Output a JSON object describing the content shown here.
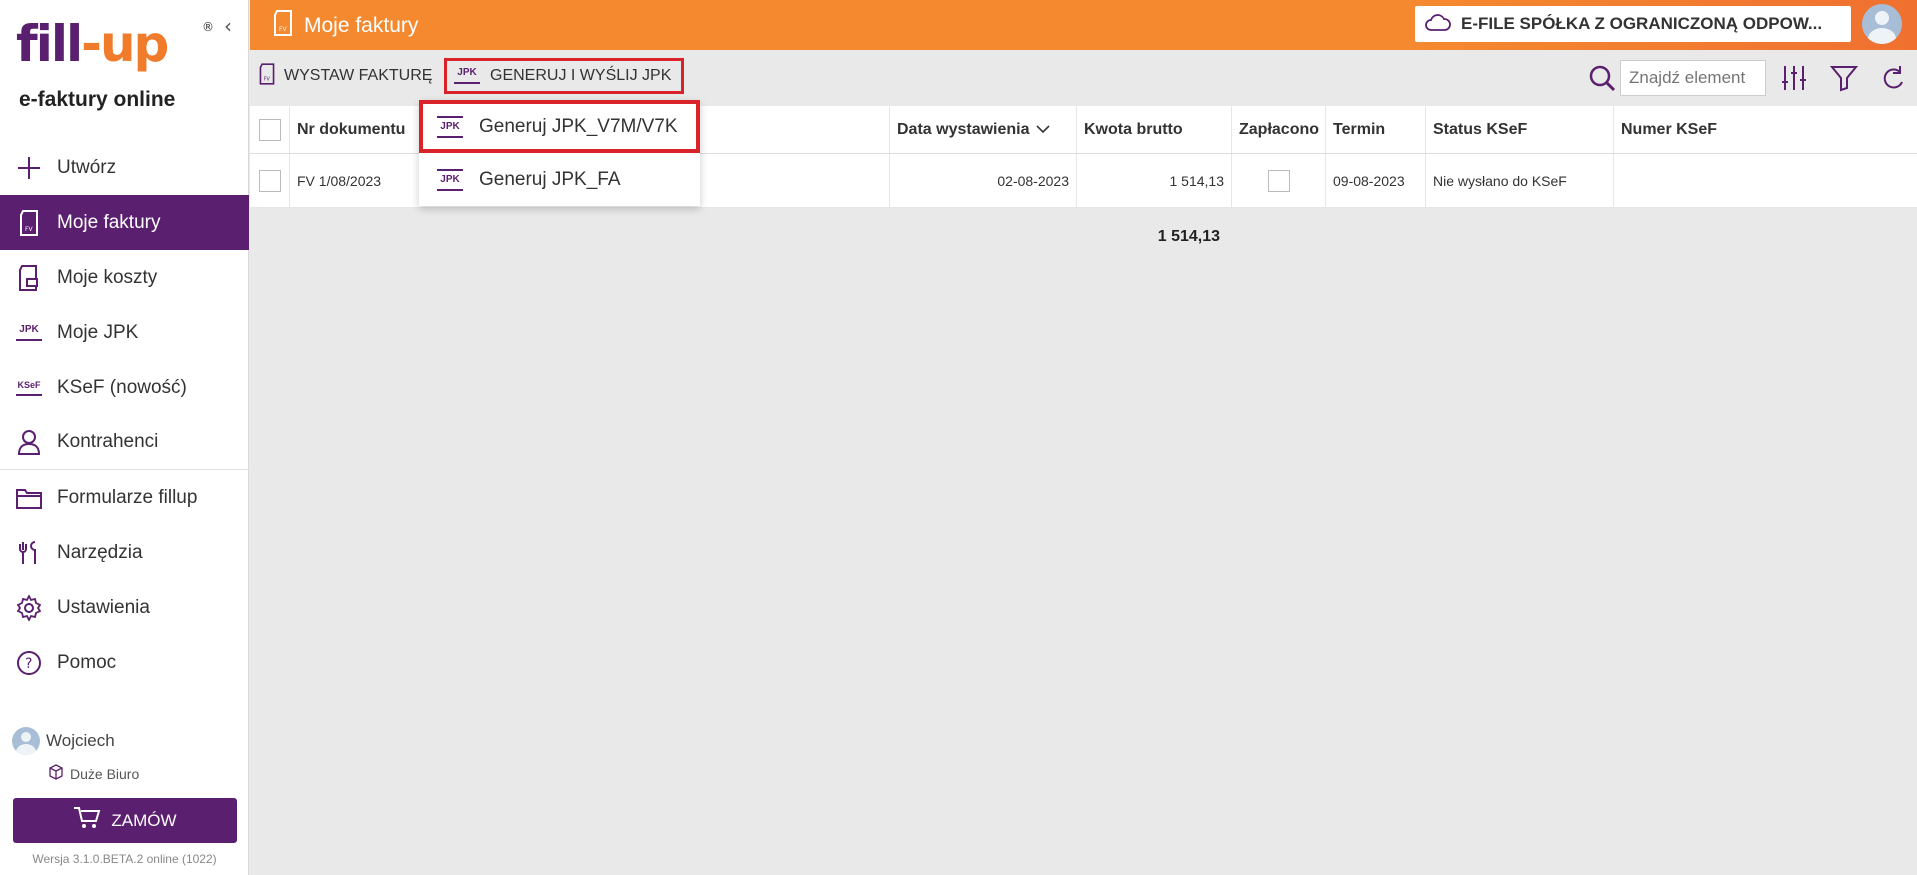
{
  "sidebar": {
    "logo": {
      "part1": "fill",
      "part2": "up",
      "reg": "®"
    },
    "subtitle": "e-faktury online",
    "items": [
      {
        "label": "Utwórz",
        "icon": "plus-icon"
      },
      {
        "label": "Moje faktury",
        "icon": "invoice-icon",
        "active": true
      },
      {
        "label": "Moje koszty",
        "icon": "costs-icon"
      },
      {
        "label": "Moje JPK",
        "icon": "jpk-icon"
      },
      {
        "label": "KSeF (nowość)",
        "icon": "ksef-icon"
      },
      {
        "label": "Kontrahenci",
        "icon": "person-icon"
      },
      {
        "label": "Formularze fillup",
        "icon": "folder-icon"
      },
      {
        "label": "Narzędzia",
        "icon": "tools-icon"
      },
      {
        "label": "Ustawienia",
        "icon": "gear-icon"
      },
      {
        "label": "Pomoc",
        "icon": "help-icon"
      }
    ],
    "user_name": "Wojciech",
    "plan": "Duże Biuro",
    "order_label": "ZAMÓW",
    "version": "Wersja 3.1.0.BETA.2 online (1022)"
  },
  "header": {
    "title": "Moje faktury",
    "company": "E-FILE SPÓŁKA Z OGRANICZONĄ ODPOW..."
  },
  "toolbar": {
    "issue_label": "WYSTAW FAKTURĘ",
    "jpk_label": "GENERUJ I WYŚLIJ JPK",
    "search_placeholder": "Znajdź element"
  },
  "dropdown": {
    "items": [
      {
        "label": "Generuj JPK_V7M/V7K",
        "icon": "jpk-icon"
      },
      {
        "label": "Generuj JPK_FA",
        "icon": "jpk-icon"
      }
    ]
  },
  "table": {
    "columns": [
      "Nr dokumentu",
      "Data wystawienia",
      "Kwota brutto",
      "Zapłacono",
      "Termin",
      "Status KSeF",
      "Numer KSeF"
    ],
    "rows": [
      {
        "nr": "FV 1/08/2023",
        "data": "02-08-2023",
        "kwota": "1 514,13",
        "zaplacono": false,
        "termin": "09-08-2023",
        "status": "Nie wysłano do KSeF",
        "numer": ""
      }
    ],
    "total": "1 514,13"
  },
  "colors": {
    "brand_purple": "#5a1f6e",
    "brand_orange": "#f4892f",
    "highlight_red": "#d8232a"
  }
}
